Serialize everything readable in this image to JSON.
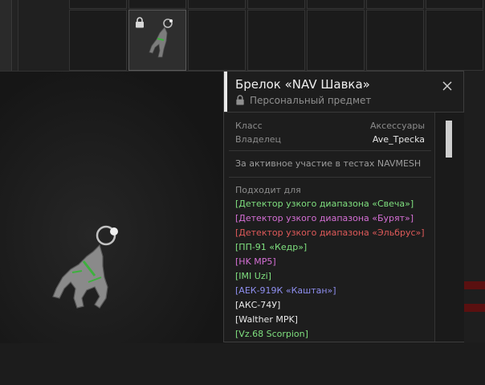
{
  "tooltip": {
    "title": "Брелок «NAV Шавка»",
    "subtitle": "Персональный предмет",
    "rows": [
      {
        "key": "Класс",
        "value": "Аксессуары"
      },
      {
        "key": "Владелец",
        "value": "Ave_Tpecka"
      }
    ],
    "description": "За активное участие в тестах NAVMESH",
    "fits_label": "Подходит для",
    "fits": [
      {
        "text": "[Детектор узкого диапазона «Свеча»]",
        "color": "#7fe07f"
      },
      {
        "text": "[Детектор узкого диапазона «Бурят»]",
        "color": "#d56fd5"
      },
      {
        "text": "[Детектор узкого диапазона «Эльбрус»]",
        "color": "#e05a5a"
      },
      {
        "text": "[ПП-91 «Кедр»]",
        "color": "#7fe07f"
      },
      {
        "text": "[HK MP5]",
        "color": "#d56fd5"
      },
      {
        "text": "[IMI Uzi]",
        "color": "#7fe07f"
      },
      {
        "text": "[АЕК-919К «Каштан»]",
        "color": "#8f8ff0"
      },
      {
        "text": "[АКС-74У]",
        "color": "#e8e8e8"
      },
      {
        "text": "[Walther MPK]",
        "color": "#e8e8e8"
      },
      {
        "text": "[Vz.68 Scorpion]",
        "color": "#7fe07f"
      }
    ]
  },
  "icons": {
    "close": "close-icon",
    "lock": "lock-icon"
  }
}
